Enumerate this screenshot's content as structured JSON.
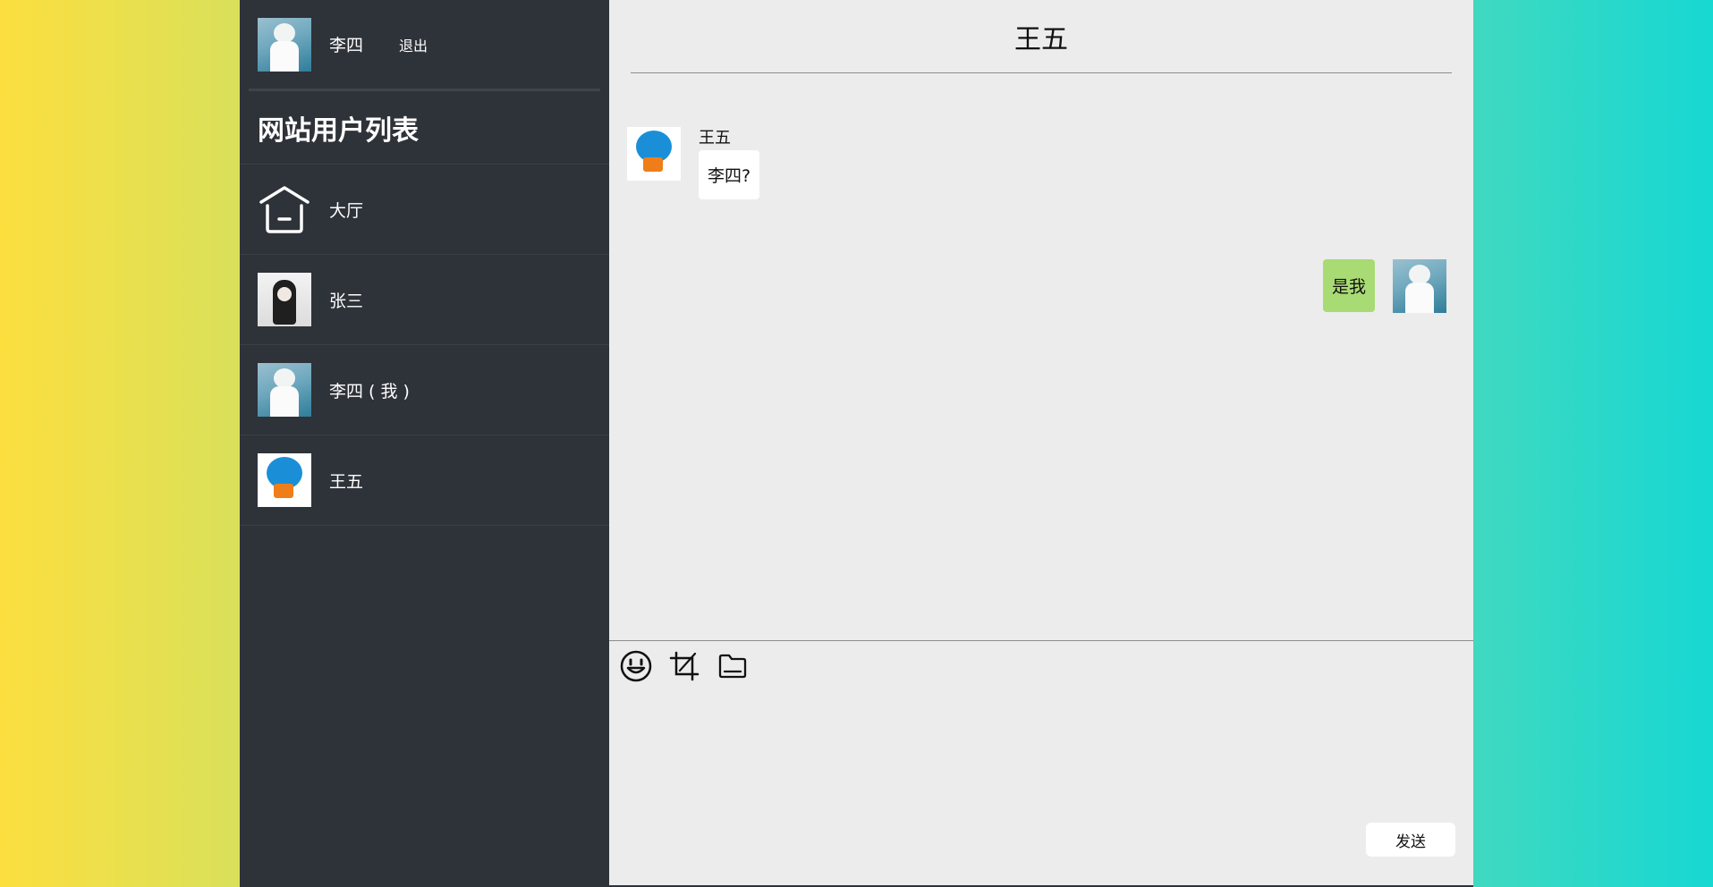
{
  "me": {
    "name": "李四",
    "logout_label": "退出"
  },
  "sidebar": {
    "title": "网站用户列表",
    "items": [
      {
        "label": "大厅",
        "icon": "home-icon"
      },
      {
        "label": "张三"
      },
      {
        "label": "李四 ( 我 )"
      },
      {
        "label": "王五"
      }
    ]
  },
  "chat": {
    "title": "王五",
    "messages": [
      {
        "sender": "王五",
        "text": "李四?",
        "side": "left"
      },
      {
        "text": "是我",
        "side": "right"
      }
    ],
    "send_label": "发送",
    "tools": [
      "emoji-icon",
      "crop-icon",
      "folder-icon"
    ]
  },
  "colors": {
    "sidebar_bg": "#2e3239",
    "chat_bg": "#ebeceb",
    "self_bubble": "#a8db73",
    "left_gradient": "#fcdf3f",
    "right_gradient": "#17d8d2"
  }
}
